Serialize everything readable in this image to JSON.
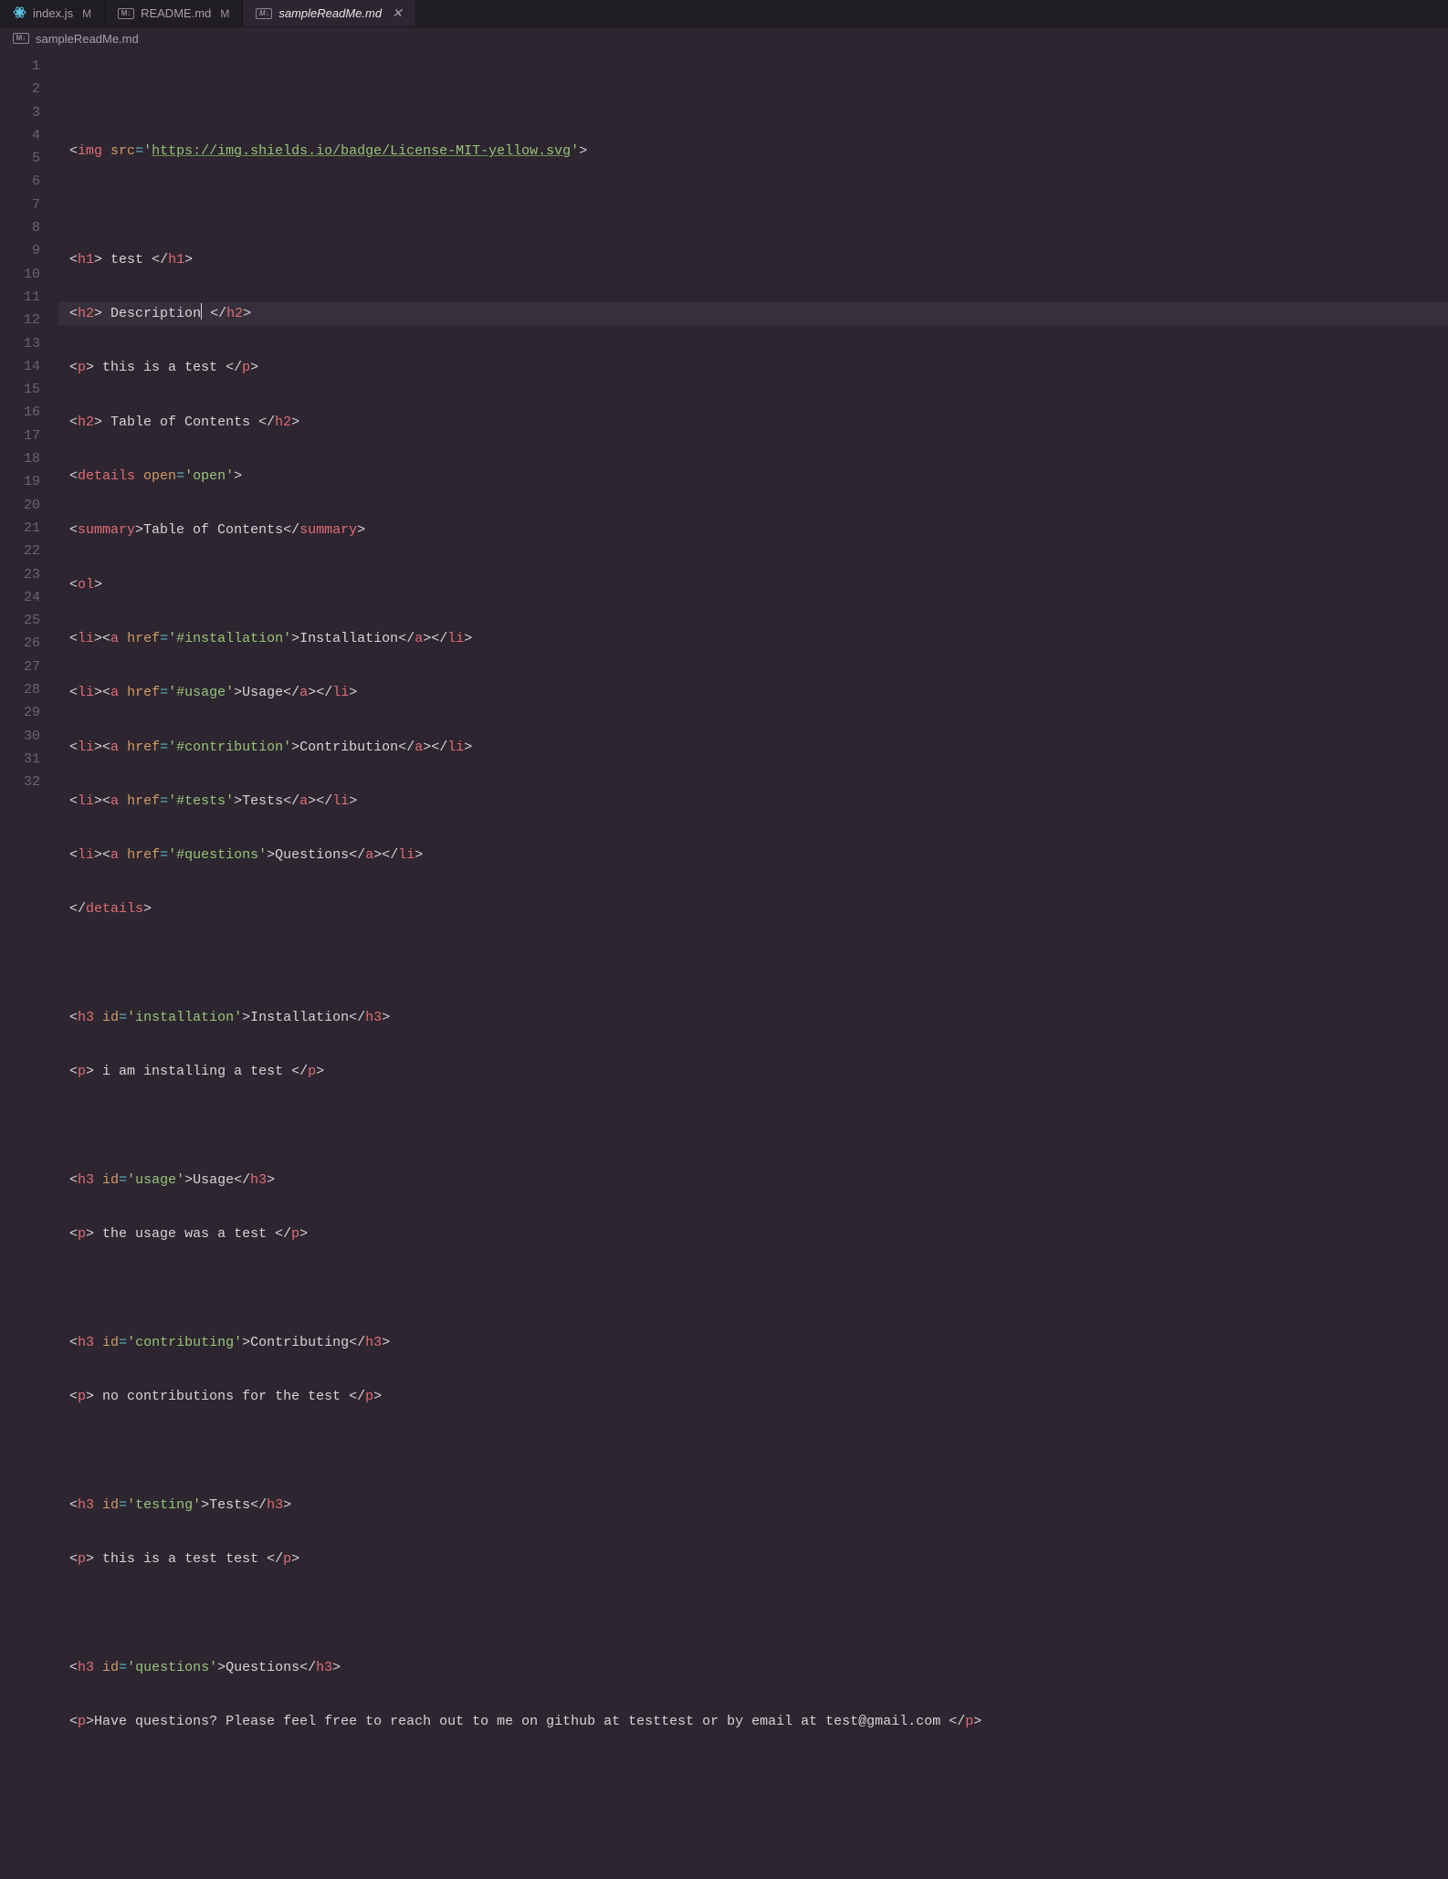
{
  "tabs": [
    {
      "label": "index.js",
      "modified": "M",
      "icon": "react",
      "active": false
    },
    {
      "label": "README.md",
      "modified": "M",
      "icon": "md",
      "active": false
    },
    {
      "label": "sampleReadMe.md",
      "modified": "",
      "icon": "md",
      "active": true,
      "close": "✕"
    }
  ],
  "breadcrumb": {
    "icon": "md",
    "label": "sampleReadMe.md"
  },
  "lineNumbers": [
    "1",
    "2",
    "3",
    "4",
    "5",
    "6",
    "7",
    "8",
    "9",
    "10",
    "11",
    "12",
    "13",
    "14",
    "15",
    "16",
    "17",
    "18",
    "19",
    "20",
    "21",
    "22",
    "23",
    "24",
    "25",
    "26",
    "27",
    "28",
    "29",
    "30",
    "31",
    "32"
  ],
  "code": {
    "l2": {
      "tag": "img",
      "attr": "src",
      "eq": "=",
      "q1": "'",
      "url": "https://img.shields.io/badge/License-MIT-yellow.svg",
      "q2": "'"
    },
    "l4": {
      "o": "h1",
      "t": " test ",
      "c": "h1"
    },
    "l5": {
      "o": "h2",
      "t": " Description",
      "c": "h2"
    },
    "l6": {
      "o": "p",
      "t": " this is a test ",
      "c": "p"
    },
    "l7": {
      "o": "h2",
      "t": " Table of Contents ",
      "c": "h2"
    },
    "l8": {
      "tag": "details",
      "attr": "open",
      "eq": "=",
      "val": "'open'"
    },
    "l9": {
      "o": "summary",
      "t": "Table of Contents",
      "c": "summary"
    },
    "l10": {
      "o": "ol"
    },
    "l11": {
      "li": "li",
      "a": "a",
      "attr": "href",
      "eq": "=",
      "val": "'#installation'",
      "t": "Installation"
    },
    "l12": {
      "li": "li",
      "a": "a",
      "attr": "href",
      "eq": "=",
      "val": "'#usage'",
      "t": "Usage"
    },
    "l13": {
      "li": "li",
      "a": "a",
      "attr": "href",
      "eq": "=",
      "val": "'#contribution'",
      "t": "Contribution"
    },
    "l14": {
      "li": "li",
      "a": "a",
      "attr": "href",
      "eq": "=",
      "val": "'#tests'",
      "t": "Tests"
    },
    "l15": {
      "li": "li",
      "a": "a",
      "attr": "href",
      "eq": "=",
      "val": "'#questions'",
      "t": "Questions"
    },
    "l16": {
      "c": "details"
    },
    "l18": {
      "o": "h3",
      "attr": "id",
      "eq": "=",
      "val": "'installation'",
      "t": "Installation",
      "c": "h3"
    },
    "l19": {
      "o": "p",
      "t": " i am installing a test ",
      "c": "p"
    },
    "l21": {
      "o": "h3",
      "attr": "id",
      "eq": "=",
      "val": "'usage'",
      "t": "Usage",
      "c": "h3"
    },
    "l22": {
      "o": "p",
      "t": " the usage was a test ",
      "c": "p"
    },
    "l24": {
      "o": "h3",
      "attr": "id",
      "eq": "=",
      "val": "'contributing'",
      "t": "Contributing",
      "c": "h3"
    },
    "l25": {
      "o": "p",
      "t": " no contributions for the test ",
      "c": "p"
    },
    "l27": {
      "o": "h3",
      "attr": "id",
      "eq": "=",
      "val": "'testing'",
      "t": "Tests",
      "c": "h3"
    },
    "l28": {
      "o": "p",
      "t": " this is a test test ",
      "c": "p"
    },
    "l30": {
      "o": "h3",
      "attr": "id",
      "eq": "=",
      "val": "'questions'",
      "t": "Questions",
      "c": "h3"
    },
    "l31": {
      "o": "p",
      "t": "Have questions? Please feel free to reach out to me on github at testtest or by email at test@gmail.com ",
      "c": "p"
    }
  }
}
